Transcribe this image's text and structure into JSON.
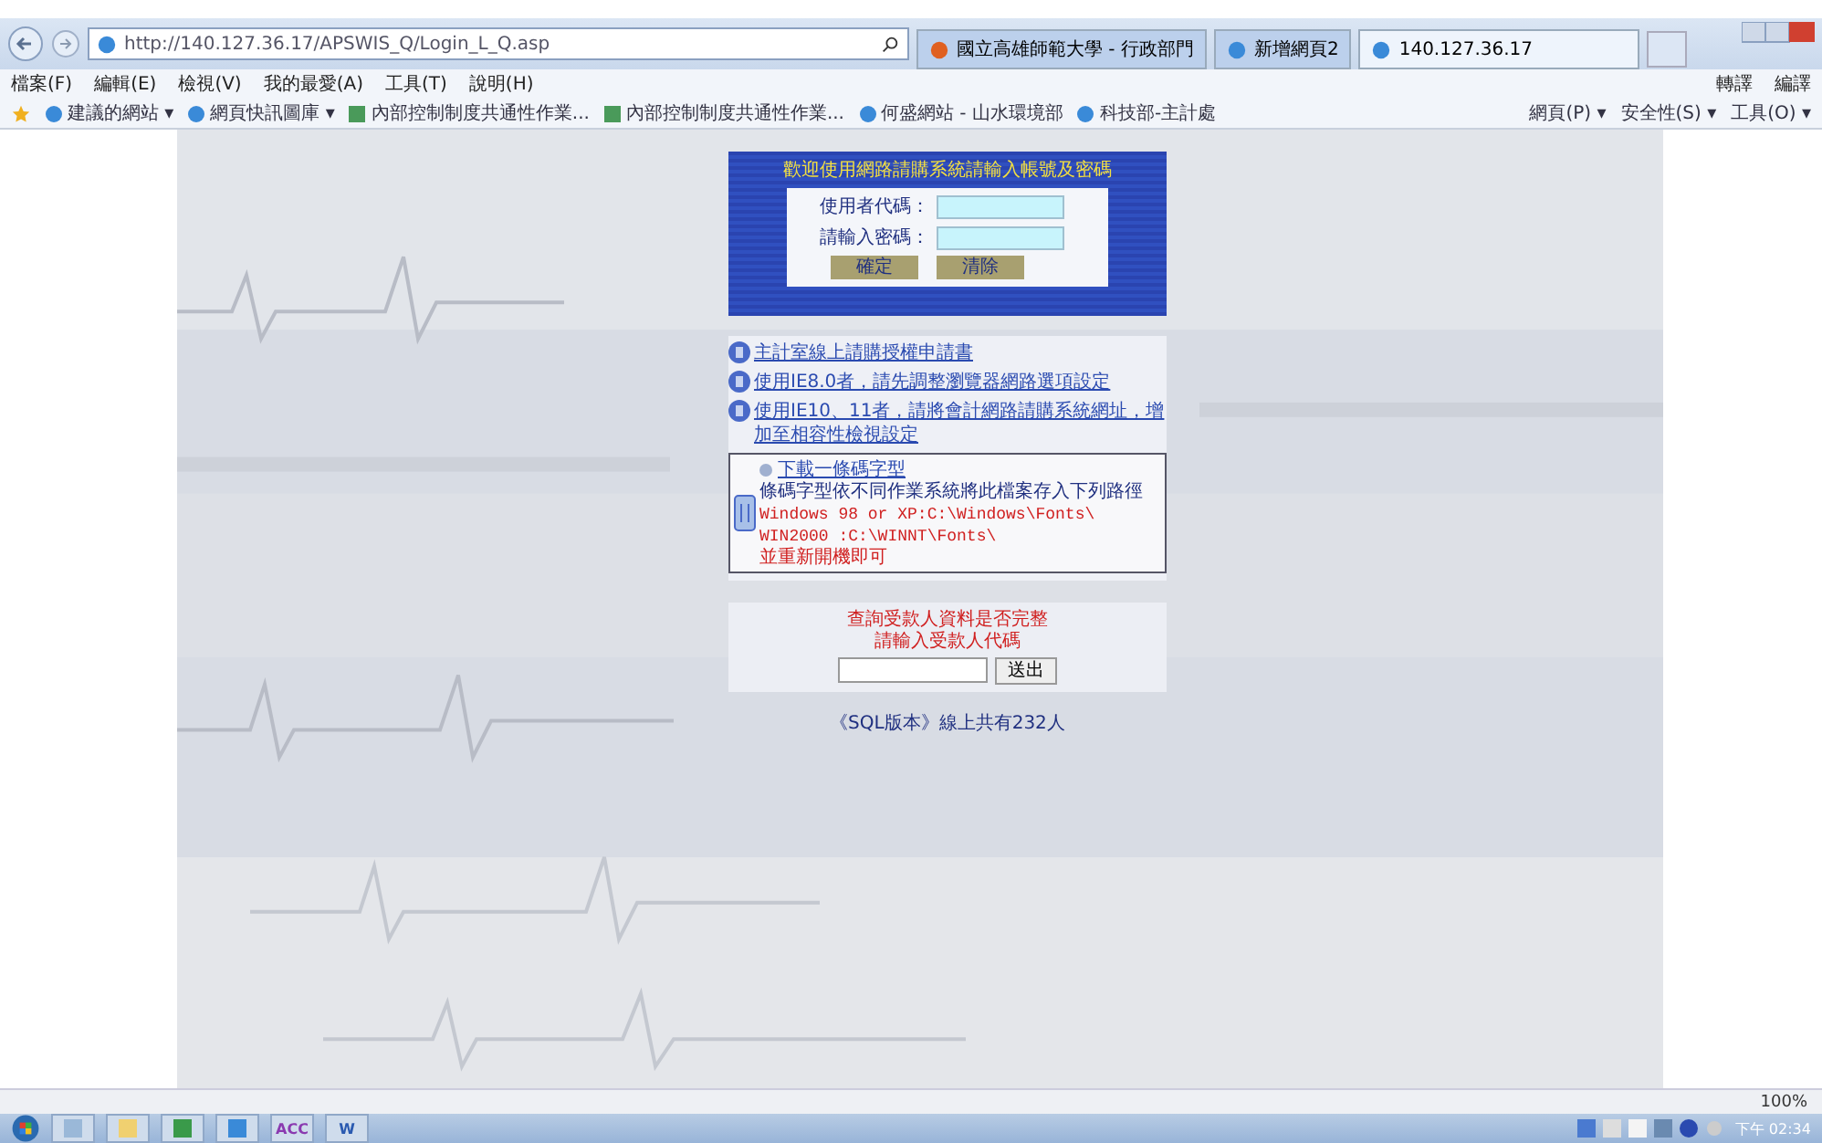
{
  "browser": {
    "address": "http://140.127.36.17/APSWIS_Q/Login_L_Q.asp",
    "tabs": [
      {
        "label": "國立高雄師範大學 - 行政部門",
        "selected": false
      },
      {
        "label": "新增網頁2",
        "selected": false
      },
      {
        "label": "140.127.36.17",
        "selected": true
      }
    ],
    "menu": [
      "檔案(F)",
      "編輯(E)",
      "檢視(V)",
      "我的最愛(A)",
      "工具(T)",
      "說明(H)"
    ],
    "right_tools": [
      "轉譯",
      "編譯"
    ],
    "favorites": [
      {
        "label": "建議的網站 ▾",
        "kind": "page"
      },
      {
        "label": "網頁快訊圖庫 ▾",
        "kind": "page"
      },
      {
        "label": "內部控制制度共通性作業...",
        "kind": "doc"
      },
      {
        "label": "內部控制制度共通性作業...",
        "kind": "doc"
      },
      {
        "label": "何盛網站 - 山水環境部",
        "kind": "page"
      },
      {
        "label": "科技部-主計處",
        "kind": "page"
      }
    ],
    "commands": [
      "網頁(P) ▾",
      "安全性(S) ▾",
      "工具(O) ▾"
    ]
  },
  "login": {
    "title": "歡迎使用網路請購系統請輸入帳號及密碼",
    "fields": [
      {
        "label": "使用者代碼："
      },
      {
        "label": "請輸入密碼："
      }
    ],
    "buttons": [
      "確定",
      "清除"
    ]
  },
  "links": [
    "主計室線上請購授權申請書",
    "使用IE8.0者，請先調整瀏覽器網路選項設定",
    "使用IE10、11者，請將會計網路請購系統網址，增加至相容性檢視設定"
  ],
  "font_box": {
    "link": "下載一條碼字型",
    "lines": [
      {
        "text": "條碼字型依不同作業系統將此檔案存入下列路徑",
        "kind": "note"
      },
      {
        "text": "Windows 98 or XP:C:\\Windows\\Fonts\\",
        "kind": "path"
      },
      {
        "text": "WIN2000 :C:\\WINNT\\Fonts\\",
        "kind": "path"
      },
      {
        "text": "並重新開機即可",
        "kind": "warn"
      }
    ]
  },
  "query": {
    "lines": [
      "查詢受款人資料是否完整",
      "請輸入受款人代碼"
    ],
    "button": "送出"
  },
  "footer": "《SQL版本》線上共有232人",
  "status": {
    "zoom": "100%"
  },
  "taskbar": {
    "apps": [
      {
        "kind": "explorer"
      },
      {
        "kind": "notes"
      },
      {
        "kind": "excel"
      },
      {
        "kind": "ie"
      },
      {
        "kind": "acc",
        "label": "ACC"
      },
      {
        "kind": "word",
        "label": "W"
      }
    ],
    "clock": "下午 02:34"
  }
}
